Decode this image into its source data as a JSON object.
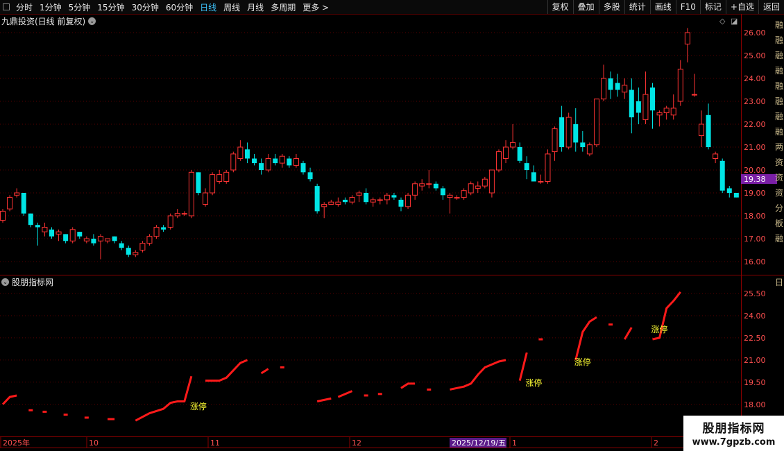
{
  "toolbar": {
    "left": [
      "分时",
      "1分钟",
      "5分钟",
      "15分钟",
      "30分钟",
      "60分钟",
      "日线",
      "周线",
      "月线",
      "多周期",
      "更多 >"
    ],
    "active_index": 6,
    "right": [
      "复权",
      "叠加",
      "多股",
      "统计",
      "画线",
      "F10",
      "标记",
      "+自选",
      "返回"
    ]
  },
  "main_panel": {
    "title": "九鼎投资(日线 前复权)",
    "y_ticks": [
      "26.00",
      "25.00",
      "24.00",
      "23.00",
      "22.00",
      "21.00",
      "20.00",
      "19.00",
      "18.00",
      "17.00",
      "16.00"
    ],
    "price_tag": "19.38",
    "side_chars": [
      "融",
      "融",
      "融",
      "融",
      "融",
      "融",
      "融",
      "融",
      "两",
      "资",
      "资",
      "资",
      "分",
      "板",
      "融"
    ]
  },
  "sub_panel": {
    "title": "股朋指标网",
    "y_ticks": [
      "25.50",
      "24.00",
      "22.50",
      "21.00",
      "19.50",
      "18.00"
    ],
    "side_top": "日",
    "limit_labels": [
      "涨停",
      "涨停",
      "涨停",
      "涨停"
    ]
  },
  "x_axis": {
    "labels": [
      "2025年",
      "10",
      "11",
      "12",
      "1",
      "2"
    ],
    "cursor_date": "2025/12/19/五"
  },
  "watermark": {
    "title": "股朋指标网",
    "url": "www.7gpzb.com"
  },
  "colors": {
    "up": "#ff3333",
    "down": "#00e5e5",
    "line": "#ff1a1a",
    "grid": "#5a0000",
    "label": "#ffff33",
    "tag": "#7a1fa6"
  },
  "chart_data": {
    "type": "candlestick",
    "candles": [
      [
        17.8,
        18.3,
        17.7,
        18.2
      ],
      [
        18.3,
        18.9,
        18.2,
        18.8
      ],
      [
        18.9,
        19.2,
        18.8,
        19.0
      ],
      [
        19.0,
        19.0,
        18.0,
        18.1
      ],
      [
        18.1,
        18.1,
        17.5,
        17.6
      ],
      [
        17.6,
        17.7,
        16.7,
        17.5
      ],
      [
        17.3,
        17.7,
        17.1,
        17.5
      ],
      [
        17.4,
        17.5,
        17.0,
        17.1
      ],
      [
        17.2,
        17.4,
        16.9,
        17.3
      ],
      [
        17.2,
        17.2,
        16.8,
        16.9
      ],
      [
        16.9,
        17.5,
        16.8,
        17.4
      ],
      [
        17.3,
        17.3,
        17.0,
        17.1
      ],
      [
        16.9,
        17.1,
        16.8,
        17.0
      ],
      [
        17.0,
        17.2,
        16.7,
        16.8
      ],
      [
        16.9,
        17.2,
        16.1,
        17.1
      ],
      [
        16.9,
        17.0,
        16.8,
        17.0
      ],
      [
        17.1,
        17.1,
        16.8,
        16.9
      ],
      [
        16.8,
        16.9,
        16.5,
        16.6
      ],
      [
        16.6,
        16.7,
        16.2,
        16.3
      ],
      [
        16.3,
        16.5,
        16.2,
        16.4
      ],
      [
        16.5,
        16.9,
        16.4,
        16.8
      ],
      [
        16.8,
        17.2,
        16.7,
        17.1
      ],
      [
        17.1,
        17.6,
        17.0,
        17.5
      ],
      [
        17.5,
        17.6,
        17.3,
        17.4
      ],
      [
        17.5,
        18.1,
        17.4,
        18.0
      ],
      [
        18.0,
        18.3,
        17.9,
        18.1
      ],
      [
        18.1,
        18.2,
        18.0,
        18.1
      ],
      [
        18.0,
        20.0,
        17.9,
        19.9
      ],
      [
        19.9,
        19.9,
        18.9,
        19.0
      ],
      [
        18.5,
        19.2,
        18.4,
        19.0
      ],
      [
        19.0,
        19.9,
        18.9,
        19.8
      ],
      [
        19.5,
        20.0,
        19.4,
        19.8
      ],
      [
        19.5,
        20.0,
        19.4,
        19.9
      ],
      [
        20.0,
        20.8,
        19.9,
        20.7
      ],
      [
        20.5,
        21.3,
        20.4,
        21.0
      ],
      [
        20.9,
        21.2,
        20.3,
        20.5
      ],
      [
        20.5,
        20.7,
        20.2,
        20.3
      ],
      [
        20.3,
        20.5,
        19.8,
        20.0
      ],
      [
        20.0,
        20.7,
        19.9,
        20.5
      ],
      [
        20.5,
        20.7,
        20.2,
        20.3
      ],
      [
        20.3,
        20.7,
        20.1,
        20.6
      ],
      [
        20.5,
        20.6,
        20.1,
        20.2
      ],
      [
        20.2,
        20.7,
        20.1,
        20.5
      ],
      [
        20.3,
        20.4,
        19.8,
        19.9
      ],
      [
        19.9,
        20.1,
        19.5,
        19.6
      ],
      [
        19.3,
        19.4,
        18.1,
        18.2
      ],
      [
        18.4,
        18.6,
        17.9,
        18.5
      ],
      [
        18.5,
        18.7,
        18.5,
        18.6
      ],
      [
        18.5,
        18.8,
        18.4,
        18.6
      ],
      [
        18.7,
        18.8,
        18.5,
        18.6
      ],
      [
        18.6,
        18.9,
        18.5,
        18.8
      ],
      [
        18.9,
        19.1,
        18.6,
        19.0
      ],
      [
        19.0,
        19.2,
        18.5,
        18.6
      ],
      [
        18.6,
        18.8,
        18.4,
        18.7
      ],
      [
        18.7,
        18.8,
        18.5,
        18.7
      ],
      [
        18.7,
        19.0,
        18.5,
        18.9
      ],
      [
        18.9,
        19.0,
        18.7,
        18.8
      ],
      [
        18.7,
        18.8,
        18.2,
        18.4
      ],
      [
        18.4,
        19.0,
        18.3,
        18.9
      ],
      [
        18.9,
        19.5,
        18.7,
        19.4
      ],
      [
        19.3,
        19.6,
        19.1,
        19.4
      ],
      [
        19.4,
        20.0,
        19.2,
        19.4
      ],
      [
        19.4,
        19.5,
        19.1,
        19.2
      ],
      [
        19.2,
        19.3,
        18.7,
        18.9
      ],
      [
        18.8,
        19.0,
        18.1,
        18.9
      ],
      [
        18.8,
        18.9,
        18.7,
        18.8
      ],
      [
        18.8,
        19.2,
        18.7,
        19.1
      ],
      [
        19.0,
        19.5,
        18.9,
        19.4
      ],
      [
        19.2,
        19.5,
        19.0,
        19.3
      ],
      [
        19.3,
        19.7,
        19.2,
        19.6
      ],
      [
        19.0,
        20.0,
        18.8,
        20.0
      ],
      [
        20.0,
        20.9,
        19.9,
        20.8
      ],
      [
        20.5,
        21.3,
        20.3,
        21.0
      ],
      [
        21.0,
        22.0,
        20.9,
        21.2
      ],
      [
        21.0,
        21.2,
        20.3,
        20.4
      ],
      [
        20.3,
        20.6,
        19.6,
        20.0
      ],
      [
        19.9,
        20.2,
        19.5,
        19.5
      ],
      [
        19.5,
        19.8,
        19.4,
        19.5
      ],
      [
        19.5,
        20.9,
        19.4,
        20.7
      ],
      [
        20.8,
        21.9,
        20.4,
        21.8
      ],
      [
        22.3,
        22.8,
        20.8,
        21.0
      ],
      [
        21.0,
        22.5,
        20.9,
        22.3
      ],
      [
        22.0,
        22.7,
        20.8,
        21.2
      ],
      [
        21.2,
        21.7,
        20.8,
        21.0
      ],
      [
        20.7,
        21.2,
        20.6,
        21.1
      ],
      [
        21.1,
        23.1,
        21.0,
        23.1
      ],
      [
        23.1,
        24.6,
        23.0,
        24.0
      ],
      [
        24.0,
        24.3,
        23.1,
        23.5
      ],
      [
        23.8,
        24.2,
        23.2,
        23.5
      ],
      [
        23.4,
        24.0,
        23.1,
        23.7
      ],
      [
        23.5,
        24.0,
        21.6,
        22.3
      ],
      [
        23.0,
        23.6,
        22.0,
        22.5
      ],
      [
        22.2,
        24.3,
        22.0,
        23.3
      ],
      [
        23.6,
        23.8,
        21.8,
        22.6
      ],
      [
        22.4,
        22.6,
        21.9,
        22.5
      ],
      [
        22.5,
        22.8,
        22.2,
        22.7
      ],
      [
        22.4,
        23.3,
        22.2,
        22.7
      ],
      [
        23.0,
        24.8,
        22.8,
        24.4
      ],
      [
        25.5,
        26.2,
        24.7,
        26.0
      ],
      [
        23.3,
        24.2,
        23.2,
        23.3
      ],
      [
        21.5,
        22.6,
        21.0,
        22.0
      ],
      [
        22.4,
        22.9,
        20.9,
        21.0
      ],
      [
        20.5,
        20.8,
        20.3,
        20.7
      ],
      [
        20.4,
        20.5,
        19.0,
        19.1
      ],
      [
        19.2,
        19.3,
        18.8,
        19.0
      ],
      [
        19.0,
        19.0,
        18.8,
        18.8
      ]
    ],
    "indicator": {
      "title": "股朋指标网",
      "segments": [
        [
          [
            0,
            18.0
          ],
          [
            1,
            18.5
          ],
          [
            2,
            18.6
          ]
        ],
        [
          [
            4,
            17.6
          ]
        ],
        [
          [
            6,
            17.5
          ]
        ],
        [
          [
            9,
            17.3
          ]
        ],
        [
          [
            12,
            17.1
          ]
        ],
        [
          [
            15,
            17.0
          ],
          [
            16,
            17.0
          ]
        ],
        [
          [
            19,
            16.9
          ],
          [
            21,
            17.4
          ],
          [
            23,
            17.7
          ],
          [
            24,
            18.1
          ],
          [
            25,
            18.2
          ],
          [
            26,
            18.2
          ],
          [
            27,
            19.9
          ]
        ],
        [
          [
            29,
            19.6
          ],
          [
            31,
            19.6
          ],
          [
            32,
            19.8
          ],
          [
            34,
            20.8
          ],
          [
            35,
            21.0
          ]
        ],
        [
          [
            37,
            20.1
          ],
          [
            38,
            20.4
          ]
        ],
        [
          [
            40,
            20.5
          ]
        ],
        [
          [
            45,
            18.2
          ],
          [
            46,
            18.3
          ],
          [
            47,
            18.4
          ]
        ],
        [
          [
            48,
            18.5
          ],
          [
            50,
            18.9
          ]
        ],
        [
          [
            52,
            18.6
          ]
        ],
        [
          [
            54,
            18.7
          ]
        ],
        [
          [
            57,
            19.1
          ],
          [
            58,
            19.4
          ],
          [
            59,
            19.4
          ]
        ],
        [
          [
            61,
            19.0
          ]
        ],
        [
          [
            64,
            19.0
          ],
          [
            66,
            19.2
          ],
          [
            67,
            19.4
          ],
          [
            68,
            20.0
          ],
          [
            69,
            20.5
          ],
          [
            71,
            20.9
          ],
          [
            72,
            21.0
          ]
        ],
        [
          [
            74,
            19.6
          ],
          [
            75,
            21.5
          ]
        ],
        [
          [
            77,
            22.4
          ]
        ],
        [
          [
            82,
            21.0
          ],
          [
            83,
            22.9
          ],
          [
            84,
            23.6
          ],
          [
            85,
            23.9
          ]
        ],
        [
          [
            87,
            23.4
          ]
        ],
        [
          [
            89,
            22.4
          ],
          [
            90,
            23.2
          ]
        ],
        [
          [
            93,
            22.4
          ],
          [
            94,
            22.5
          ],
          [
            95,
            24.5
          ],
          [
            96,
            25.0
          ],
          [
            97,
            25.6
          ]
        ]
      ],
      "limit_up_at": [
        [
          27,
          17.9
        ],
        [
          75,
          19.5
        ],
        [
          82,
          20.9
        ],
        [
          93,
          23.1
        ]
      ]
    }
  }
}
